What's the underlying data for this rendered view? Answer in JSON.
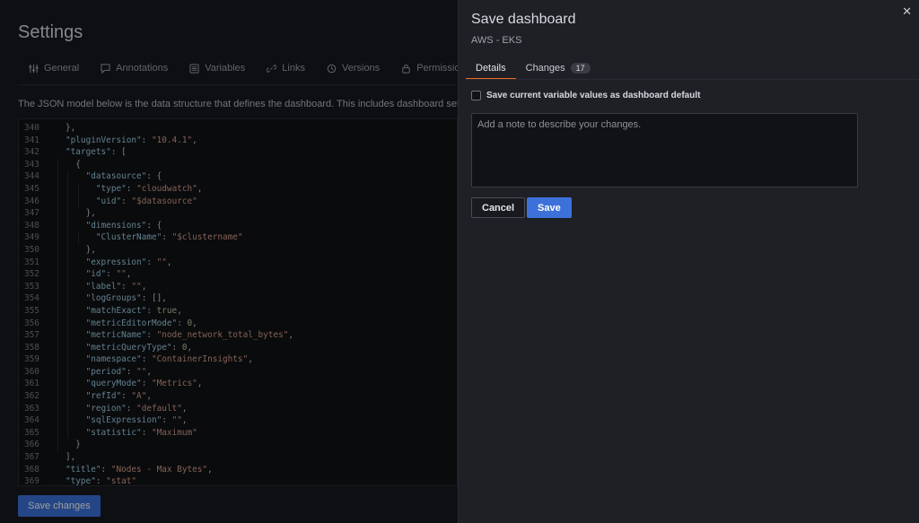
{
  "settings": {
    "title": "Settings",
    "tabs": [
      {
        "label": "General",
        "icon": "sliders-icon"
      },
      {
        "label": "Annotations",
        "icon": "comment-icon"
      },
      {
        "label": "Variables",
        "icon": "variables-icon"
      },
      {
        "label": "Links",
        "icon": "link-icon"
      },
      {
        "label": "Versions",
        "icon": "history-icon"
      },
      {
        "label": "Permission",
        "icon": "lock-icon"
      }
    ],
    "description": "The JSON model below is the data structure that defines the dashboard. This includes dashboard sett",
    "save_changes_label": "Save changes"
  },
  "json_editor": {
    "lines": [
      {
        "n": "340",
        "indent": 3,
        "t": [
          [
            "p",
            "},"
          ]
        ]
      },
      {
        "n": "341",
        "indent": 3,
        "t": [
          [
            "k",
            "\"pluginVersion\""
          ],
          [
            "p",
            ": "
          ],
          [
            "s",
            "\"10.4.1\""
          ],
          [
            "p",
            ","
          ]
        ]
      },
      {
        "n": "342",
        "indent": 3,
        "t": [
          [
            "k",
            "\"targets\""
          ],
          [
            "p",
            ": ["
          ]
        ]
      },
      {
        "n": "343",
        "indent": 4,
        "t": [
          [
            "p",
            "{"
          ]
        ]
      },
      {
        "n": "344",
        "indent": 5,
        "t": [
          [
            "k",
            "\"datasource\""
          ],
          [
            "p",
            ": {"
          ]
        ]
      },
      {
        "n": "345",
        "indent": 6,
        "t": [
          [
            "k",
            "\"type\""
          ],
          [
            "p",
            ": "
          ],
          [
            "s",
            "\"cloudwatch\""
          ],
          [
            "p",
            ","
          ]
        ]
      },
      {
        "n": "346",
        "indent": 6,
        "t": [
          [
            "k",
            "\"uid\""
          ],
          [
            "p",
            ": "
          ],
          [
            "s",
            "\"$datasource\""
          ]
        ]
      },
      {
        "n": "347",
        "indent": 5,
        "t": [
          [
            "p",
            "},"
          ]
        ]
      },
      {
        "n": "348",
        "indent": 5,
        "t": [
          [
            "k",
            "\"dimensions\""
          ],
          [
            "p",
            ": {"
          ]
        ]
      },
      {
        "n": "349",
        "indent": 6,
        "t": [
          [
            "k",
            "\"ClusterName\""
          ],
          [
            "p",
            ": "
          ],
          [
            "s",
            "\"$clustername\""
          ]
        ]
      },
      {
        "n": "350",
        "indent": 5,
        "t": [
          [
            "p",
            "},"
          ]
        ]
      },
      {
        "n": "351",
        "indent": 5,
        "t": [
          [
            "k",
            "\"expression\""
          ],
          [
            "p",
            ": "
          ],
          [
            "s",
            "\"\""
          ],
          [
            "p",
            ","
          ]
        ]
      },
      {
        "n": "352",
        "indent": 5,
        "t": [
          [
            "k",
            "\"id\""
          ],
          [
            "p",
            ": "
          ],
          [
            "s",
            "\"\""
          ],
          [
            "p",
            ","
          ]
        ]
      },
      {
        "n": "353",
        "indent": 5,
        "t": [
          [
            "k",
            "\"label\""
          ],
          [
            "p",
            ": "
          ],
          [
            "s",
            "\"\""
          ],
          [
            "p",
            ","
          ]
        ]
      },
      {
        "n": "354",
        "indent": 5,
        "t": [
          [
            "k",
            "\"logGroups\""
          ],
          [
            "p",
            ": [],"
          ]
        ]
      },
      {
        "n": "355",
        "indent": 5,
        "t": [
          [
            "k",
            "\"matchExact\""
          ],
          [
            "p",
            ": "
          ],
          [
            "n",
            "true"
          ],
          [
            "p",
            ","
          ]
        ]
      },
      {
        "n": "356",
        "indent": 5,
        "t": [
          [
            "k",
            "\"metricEditorMode\""
          ],
          [
            "p",
            ": "
          ],
          [
            "n",
            "0"
          ],
          [
            "p",
            ","
          ]
        ]
      },
      {
        "n": "357",
        "indent": 5,
        "t": [
          [
            "k",
            "\"metricName\""
          ],
          [
            "p",
            ": "
          ],
          [
            "s",
            "\"node_network_total_bytes\""
          ],
          [
            "p",
            ","
          ]
        ]
      },
      {
        "n": "358",
        "indent": 5,
        "t": [
          [
            "k",
            "\"metricQueryType\""
          ],
          [
            "p",
            ": "
          ],
          [
            "n",
            "0"
          ],
          [
            "p",
            ","
          ]
        ]
      },
      {
        "n": "359",
        "indent": 5,
        "t": [
          [
            "k",
            "\"namespace\""
          ],
          [
            "p",
            ": "
          ],
          [
            "s",
            "\"ContainerInsights\""
          ],
          [
            "p",
            ","
          ]
        ]
      },
      {
        "n": "360",
        "indent": 5,
        "t": [
          [
            "k",
            "\"period\""
          ],
          [
            "p",
            ": "
          ],
          [
            "s",
            "\"\""
          ],
          [
            "p",
            ","
          ]
        ]
      },
      {
        "n": "361",
        "indent": 5,
        "t": [
          [
            "k",
            "\"queryMode\""
          ],
          [
            "p",
            ": "
          ],
          [
            "s",
            "\"Metrics\""
          ],
          [
            "p",
            ","
          ]
        ]
      },
      {
        "n": "362",
        "indent": 5,
        "t": [
          [
            "k",
            "\"refId\""
          ],
          [
            "p",
            ": "
          ],
          [
            "s",
            "\"A\""
          ],
          [
            "p",
            ","
          ]
        ]
      },
      {
        "n": "363",
        "indent": 5,
        "t": [
          [
            "k",
            "\"region\""
          ],
          [
            "p",
            ": "
          ],
          [
            "s",
            "\"default\""
          ],
          [
            "p",
            ","
          ]
        ]
      },
      {
        "n": "364",
        "indent": 5,
        "t": [
          [
            "k",
            "\"sqlExpression\""
          ],
          [
            "p",
            ": "
          ],
          [
            "s",
            "\"\""
          ],
          [
            "p",
            ","
          ]
        ]
      },
      {
        "n": "365",
        "indent": 5,
        "t": [
          [
            "k",
            "\"statistic\""
          ],
          [
            "p",
            ": "
          ],
          [
            "s",
            "\"Maximum\""
          ]
        ]
      },
      {
        "n": "366",
        "indent": 4,
        "t": [
          [
            "p",
            "}"
          ]
        ]
      },
      {
        "n": "367",
        "indent": 3,
        "t": [
          [
            "p",
            "],"
          ]
        ]
      },
      {
        "n": "368",
        "indent": 3,
        "t": [
          [
            "k",
            "\"title\""
          ],
          [
            "p",
            ": "
          ],
          [
            "s",
            "\"Nodes - Max Bytes\""
          ],
          [
            "p",
            ","
          ]
        ]
      },
      {
        "n": "369",
        "indent": 3,
        "t": [
          [
            "k",
            "\"type\""
          ],
          [
            "p",
            ": "
          ],
          [
            "s",
            "\"stat\""
          ]
        ]
      }
    ]
  },
  "drawer": {
    "title": "Save dashboard",
    "subtitle": "AWS - EKS",
    "close_icon": "close-icon",
    "tabs": {
      "details": "Details",
      "changes": "Changes",
      "changes_count": "17"
    },
    "checkbox_label": "Save current variable values as dashboard default",
    "note_placeholder": "Add a note to describe your changes.",
    "cancel_label": "Cancel",
    "save_label": "Save"
  },
  "colors": {
    "accent": "#3d71d9",
    "active_tab": "#f06b25",
    "background": "#111217",
    "drawer_bg": "#1f2025"
  }
}
